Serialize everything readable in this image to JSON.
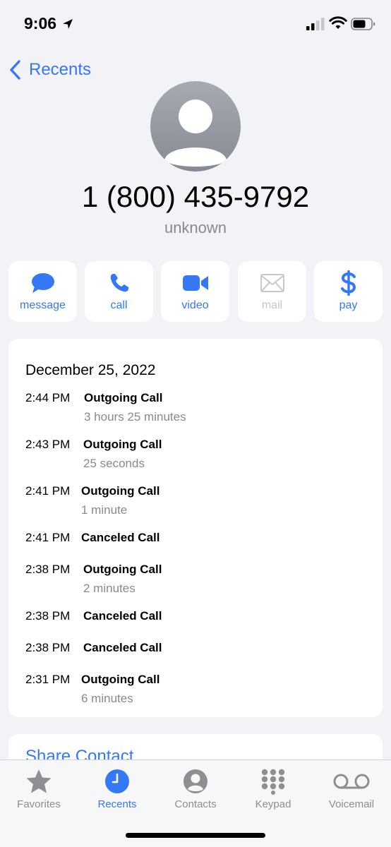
{
  "status_bar": {
    "time": "9:06"
  },
  "nav": {
    "back_label": "Recents"
  },
  "contact": {
    "number": "1 (800) 435-9792",
    "label": "unknown"
  },
  "actions": [
    {
      "label": "message",
      "icon": "message-bubble-icon",
      "enabled": true
    },
    {
      "label": "call",
      "icon": "phone-icon",
      "enabled": true
    },
    {
      "label": "video",
      "icon": "video-camera-icon",
      "enabled": true
    },
    {
      "label": "mail",
      "icon": "envelope-icon",
      "enabled": false
    },
    {
      "label": "pay",
      "icon": "dollar-icon",
      "enabled": true
    }
  ],
  "history": {
    "date": "December 25, 2022",
    "entries": [
      {
        "time": "2:44 PM",
        "type": "Outgoing Call",
        "duration": "3 hours 25 minutes"
      },
      {
        "time": "2:43 PM",
        "type": "Outgoing Call",
        "duration": "25 seconds"
      },
      {
        "time": "2:41 PM",
        "type": "Outgoing Call",
        "duration": "1 minute"
      },
      {
        "time": "2:41 PM",
        "type": "Canceled Call",
        "duration": ""
      },
      {
        "time": "2:38 PM",
        "type": "Outgoing Call",
        "duration": "2 minutes"
      },
      {
        "time": "2:38 PM",
        "type": "Canceled Call",
        "duration": ""
      },
      {
        "time": "2:38 PM",
        "type": "Canceled Call",
        "duration": ""
      },
      {
        "time": "2:31 PM",
        "type": "Outgoing Call",
        "duration": "6 minutes"
      }
    ]
  },
  "share": {
    "label": "Share Contact"
  },
  "tabs": [
    {
      "label": "Favorites",
      "icon": "star-icon",
      "active": false
    },
    {
      "label": "Recents",
      "icon": "clock-icon",
      "active": true
    },
    {
      "label": "Contacts",
      "icon": "person-circle-icon",
      "active": false
    },
    {
      "label": "Keypad",
      "icon": "keypad-icon",
      "active": false
    },
    {
      "label": "Voicemail",
      "icon": "voicemail-icon",
      "active": false
    }
  ],
  "colors": {
    "accent": "#3478f6",
    "secondary_text": "#8a8a8e",
    "background": "#f2f2f7"
  }
}
